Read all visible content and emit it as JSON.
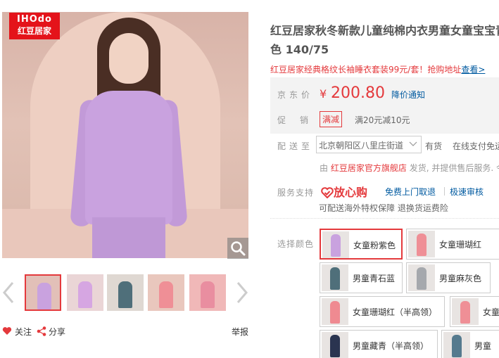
{
  "brand": {
    "logo_top": "IHOdo",
    "logo_bottom": "红豆居家"
  },
  "actions": {
    "follow": "关注",
    "share": "分享",
    "report": "举报"
  },
  "product": {
    "title_line1": "红豆居家秋冬新款儿童纯棉内衣男童女童宝宝青",
    "title_line2": "色 140/75",
    "promo_text": "红豆居家经典格纹长袖睡衣套装99元/套！抢购地址",
    "promo_link": "查看>"
  },
  "price": {
    "label": "京东价",
    "currency": "¥",
    "value": "200.80",
    "notice": "降价通知"
  },
  "promotion": {
    "label": "促销",
    "tag": "满减",
    "desc": "满20元减10元"
  },
  "shipping": {
    "label": "配送至",
    "address": "北京朝阳区八里庄街道",
    "stock": "有货",
    "payment": "在线支付免运"
  },
  "seller": {
    "prefix": "由",
    "shop": "红豆居家官方旗舰店",
    "suffix": "发货, 并提供售后服务. 今"
  },
  "service": {
    "label": "服务支持",
    "guarantee": "放心购",
    "item1": "免费上门取退",
    "item2": "极速审核",
    "line2": "可配送海外特权保障 退换货运费险"
  },
  "colors": {
    "label": "选择颜色",
    "options": [
      {
        "name": "女童粉紫色",
        "color": "#c9a2df"
      },
      {
        "name": "女童珊瑚红",
        "color": "#ef8f96"
      },
      {
        "name": "男童青石蓝",
        "color": "#4f6f7a"
      },
      {
        "name": "男童麻灰色",
        "color": "#a5a8ad"
      },
      {
        "name": "女童珊瑚红（半高领）",
        "color": "#ef8a91"
      },
      {
        "name": "女童",
        "color": "#ef8f96"
      },
      {
        "name": "男童藏青（半高领）",
        "color": "#2a3450"
      },
      {
        "name": "男童",
        "color": "#557a8e"
      }
    ]
  },
  "thumbnails": [
    {
      "bg": "#e2c0b8",
      "fig": "#c9a2df"
    },
    {
      "bg": "#ead5d6",
      "fig": "#d6a6e2"
    },
    {
      "bg": "#dfd8d2",
      "fig": "#4f6f7a"
    },
    {
      "bg": "#e9c7bd",
      "fig": "#ef8f96"
    },
    {
      "bg": "#f0b8b8",
      "fig": "#e98ea0"
    }
  ]
}
